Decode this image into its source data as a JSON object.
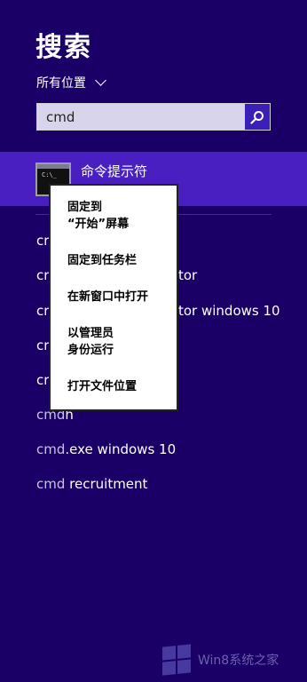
{
  "title": "搜索",
  "scope": {
    "label": "所有位置"
  },
  "search": {
    "value": "cmd",
    "button": "search"
  },
  "top_result": {
    "label": "命令提示符",
    "icon_text": "C:\\_"
  },
  "results": [
    {
      "prefix": "cr",
      "suffix": ""
    },
    {
      "prefix": "cr",
      "suffix": "tor"
    },
    {
      "prefix": "cr",
      "suffix": "tor windows 10"
    },
    {
      "prefix": "cr",
      "suffix": ""
    },
    {
      "prefix": "cr",
      "suffix": ""
    },
    {
      "prefix": "cmd",
      "suffix": "h"
    },
    {
      "prefix": "cmd",
      "suffix": ".exe windows 10"
    },
    {
      "prefix": "cmd",
      "suffix": " recruitment"
    }
  ],
  "context_menu": {
    "items": [
      "固定到\n“开始”屏幕",
      "固定到任务栏",
      "在新窗口中打开",
      "以管理员\n身份运行",
      "打开文件位置"
    ]
  },
  "watermark": {
    "text": "Win8系统之家"
  },
  "colors": {
    "background": "#1a0066",
    "highlight": "#4a1fc2",
    "search_button": "#3b1fb8"
  }
}
